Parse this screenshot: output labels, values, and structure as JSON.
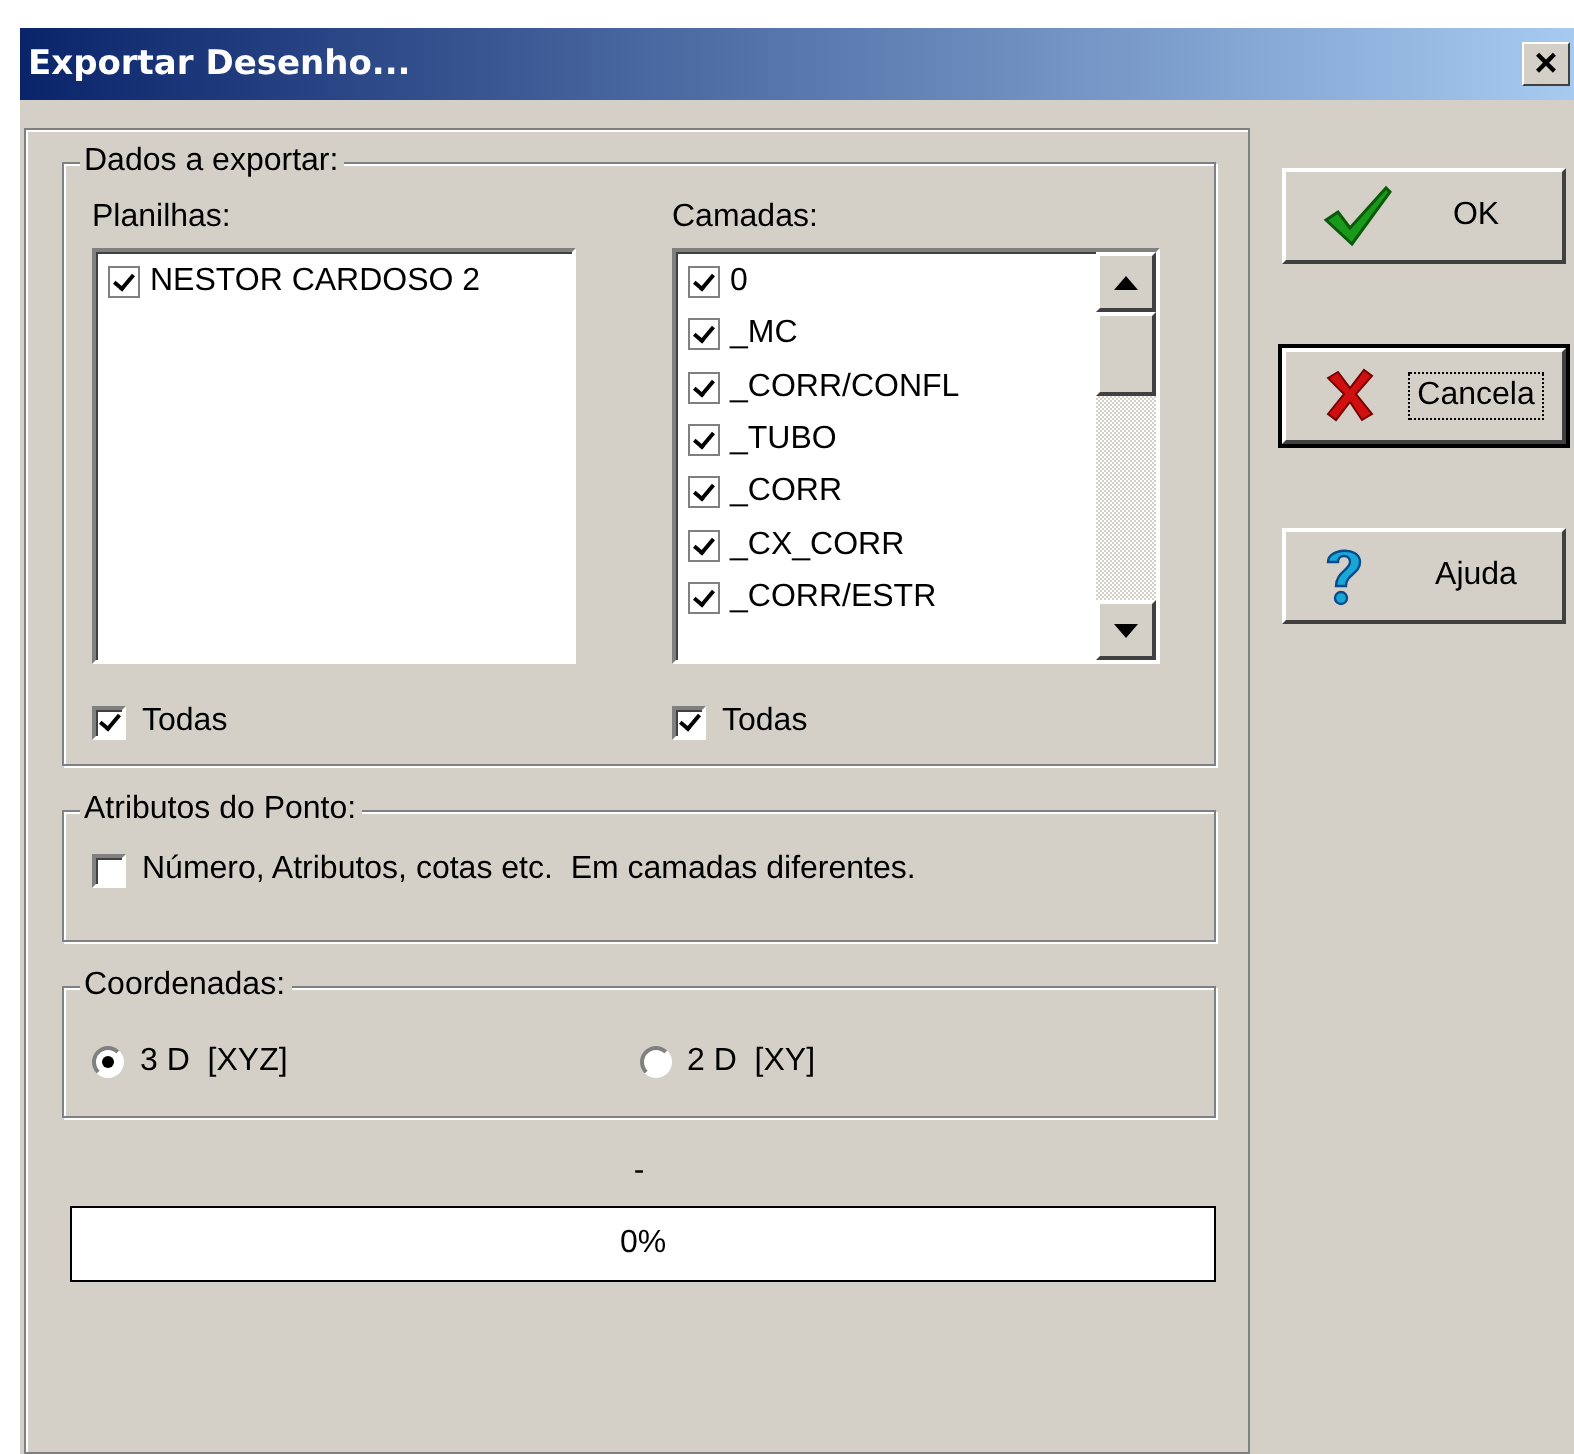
{
  "window": {
    "title": "Exportar Desenho...",
    "close": "×"
  },
  "export_data": {
    "title": "Dados a exportar:",
    "sheets": {
      "label": "Planilhas:",
      "items": [
        {
          "text": "NESTOR CARDOSO 2",
          "checked": true
        }
      ],
      "all": {
        "text": "Todas",
        "checked": true
      }
    },
    "layers": {
      "label": "Camadas:",
      "items": [
        {
          "text": "0",
          "checked": true
        },
        {
          "text": "_MC",
          "checked": true
        },
        {
          "text": "_CORR/CONFL",
          "checked": true
        },
        {
          "text": "_TUBO",
          "checked": true
        },
        {
          "text": "_CORR",
          "checked": true
        },
        {
          "text": "_CX_CORR",
          "checked": true
        },
        {
          "text": "_CORR/ESTR",
          "checked": true
        }
      ],
      "all": {
        "text": "Todas",
        "checked": true
      }
    }
  },
  "point_attributes": {
    "title": "Atributos do Ponto:",
    "option": {
      "text": "Número, Atributos, cotas etc.  Em camadas diferentes.",
      "checked": false
    }
  },
  "coordinates": {
    "title": "Coordenadas:",
    "options": [
      {
        "text": "3 D  [XYZ]",
        "selected": true
      },
      {
        "text": "2 D  [XY]",
        "selected": false
      }
    ]
  },
  "status": "-",
  "progress": {
    "level": 0,
    "text": "0%"
  },
  "buttons": [
    {
      "kind": "ok",
      "label": "OK",
      "focused": false
    },
    {
      "kind": "cancel",
      "label": "Cancela",
      "focused": true
    },
    {
      "kind": "help",
      "label": "Ajuda",
      "focused": false
    }
  ]
}
